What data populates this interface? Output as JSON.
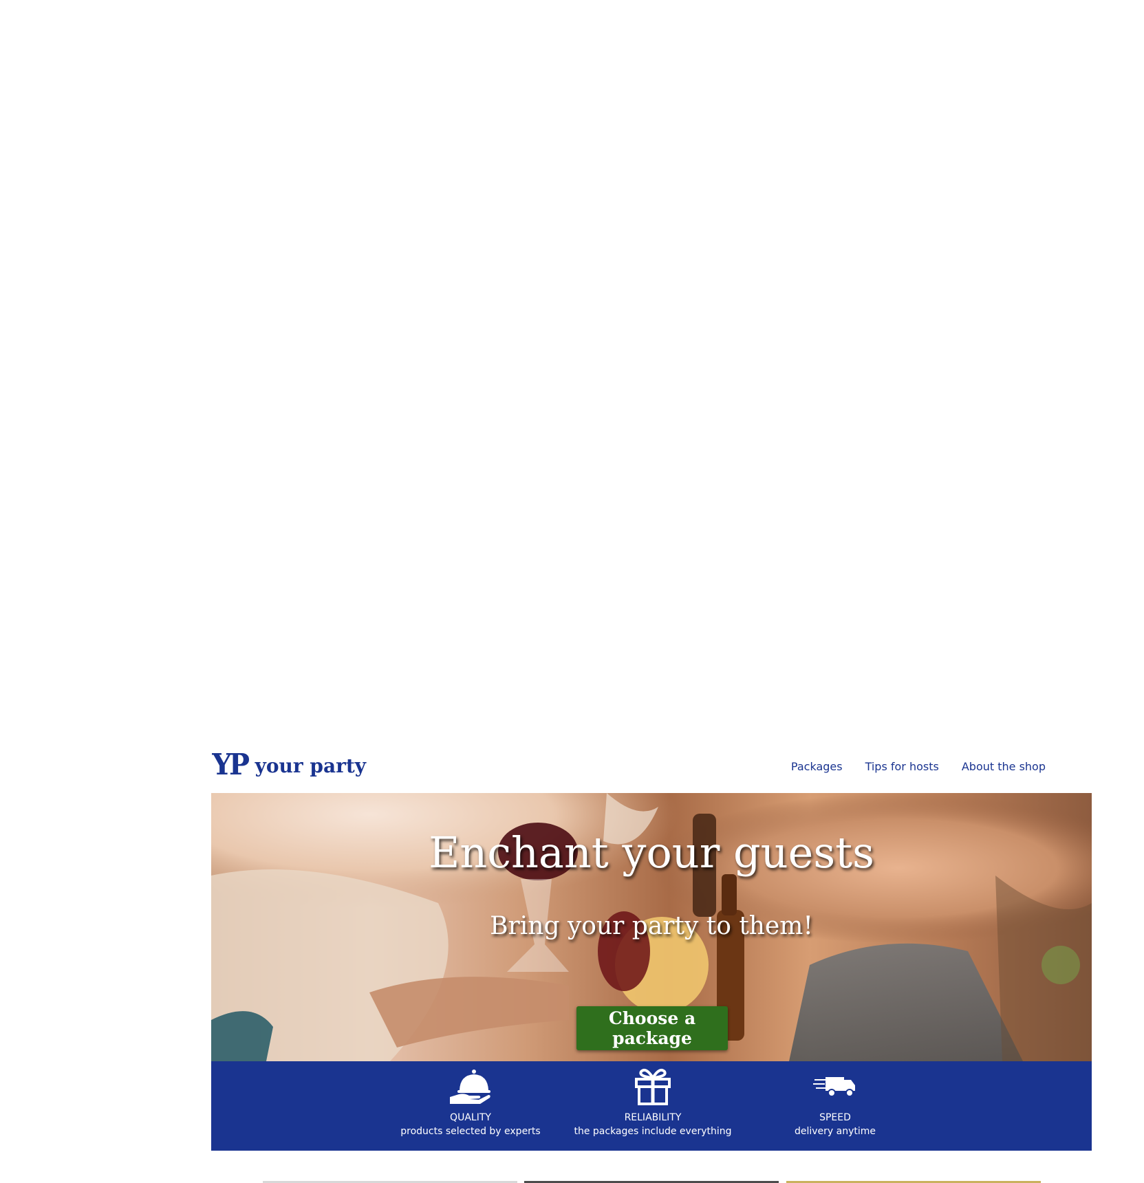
{
  "brand": {
    "logo_mark": "YP",
    "name": "your party"
  },
  "nav": [
    {
      "label": "Packages"
    },
    {
      "label": "Tips for hosts"
    },
    {
      "label": "About the shop"
    }
  ],
  "hero": {
    "title": "Enchant your guests",
    "subtitle": "Bring your party to them!",
    "cta_label": "Choose a package"
  },
  "features": [
    {
      "icon": "cloche-icon",
      "title": "QUALITY",
      "description": "products selected by experts"
    },
    {
      "icon": "gift-icon",
      "title": "RELIABILITY",
      "description": "the packages include everything"
    },
    {
      "icon": "delivery-truck-icon",
      "title": "SPEED",
      "description": "delivery anytime"
    }
  ],
  "colors": {
    "brand_blue": "#1a3490",
    "cta_green": "#2f6f1d",
    "text_white": "#ffffff"
  }
}
